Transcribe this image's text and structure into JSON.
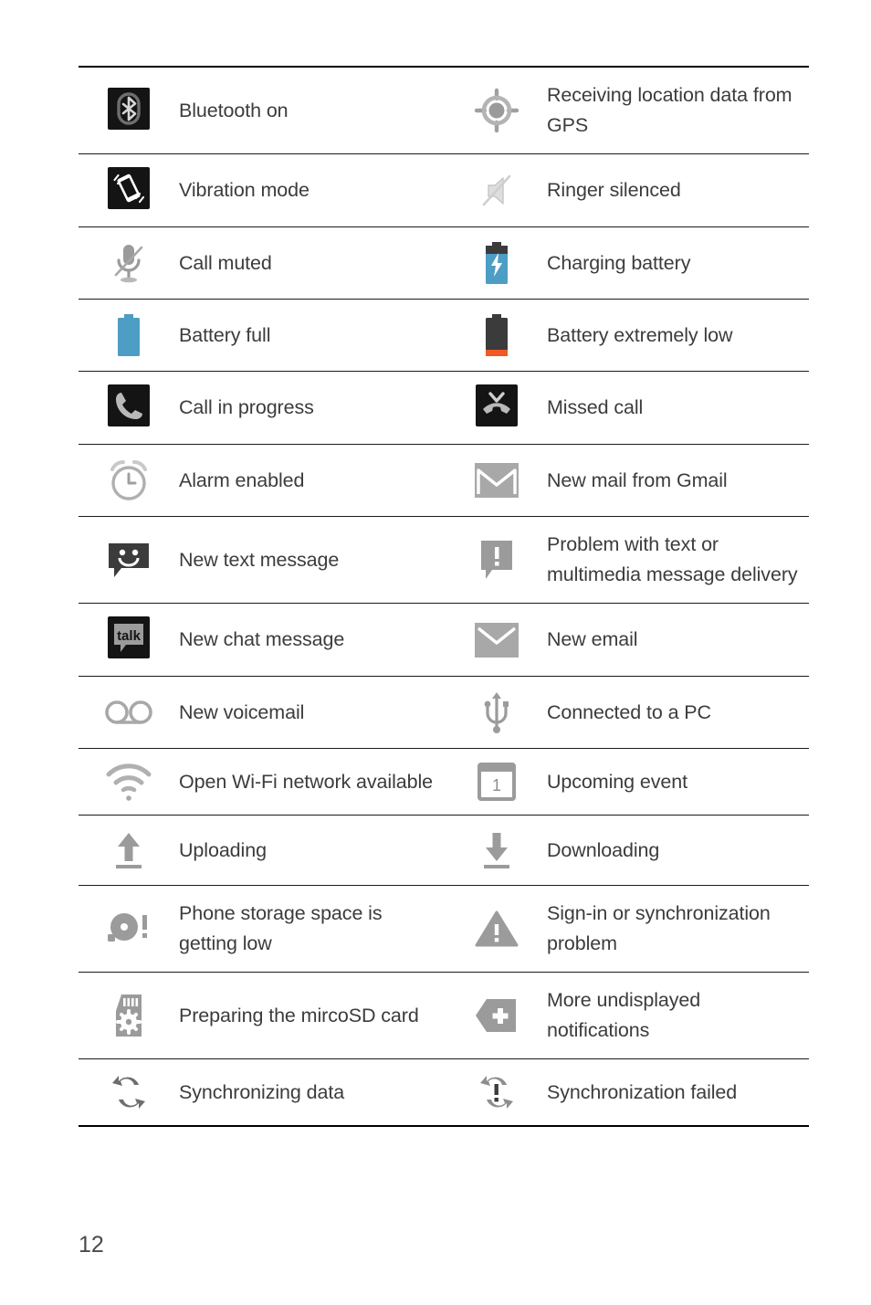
{
  "document": {
    "page_number": "12"
  },
  "table": {
    "rows": [
      {
        "left": {
          "icon": "bluetooth-on-icon",
          "label": "Bluetooth on"
        },
        "right": {
          "icon": "gps-location-icon",
          "label": "Receiving location data from GPS"
        }
      },
      {
        "left": {
          "icon": "vibration-mode-icon",
          "label": "Vibration mode"
        },
        "right": {
          "icon": "ringer-silenced-icon",
          "label": "Ringer silenced"
        }
      },
      {
        "left": {
          "icon": "call-muted-icon",
          "label": "Call muted"
        },
        "right": {
          "icon": "charging-battery-icon",
          "label": "Charging battery"
        }
      },
      {
        "left": {
          "icon": "battery-full-icon",
          "label": "Battery full"
        },
        "right": {
          "icon": "battery-extremely-low-icon",
          "label": "Battery extremely low"
        }
      },
      {
        "left": {
          "icon": "call-in-progress-icon",
          "label": "Call in progress"
        },
        "right": {
          "icon": "missed-call-icon",
          "label": "Missed call"
        }
      },
      {
        "left": {
          "icon": "alarm-enabled-icon",
          "label": "Alarm enabled"
        },
        "right": {
          "icon": "gmail-icon",
          "label": "New mail from Gmail"
        }
      },
      {
        "left": {
          "icon": "new-text-message-icon",
          "label": "New text message"
        },
        "right": {
          "icon": "message-delivery-problem-icon",
          "label": "Problem with text or multimedia message delivery"
        }
      },
      {
        "left": {
          "icon": "new-chat-message-icon",
          "label": "New chat message"
        },
        "right": {
          "icon": "new-email-icon",
          "label": "New email"
        }
      },
      {
        "left": {
          "icon": "new-voicemail-icon",
          "label": "New voicemail"
        },
        "right": {
          "icon": "usb-connected-icon",
          "label": "Connected to a PC"
        }
      },
      {
        "left": {
          "icon": "open-wifi-network-icon",
          "label": "Open Wi-Fi network available"
        },
        "right": {
          "icon": "upcoming-event-icon",
          "label": "Upcoming event"
        }
      },
      {
        "left": {
          "icon": "uploading-icon",
          "label": "Uploading"
        },
        "right": {
          "icon": "downloading-icon",
          "label": "Downloading"
        }
      },
      {
        "left": {
          "icon": "storage-low-icon",
          "label": "Phone storage space is getting low"
        },
        "right": {
          "icon": "sync-problem-warning-icon",
          "label": "Sign-in or synchronization problem"
        }
      },
      {
        "left": {
          "icon": "preparing-microsd-icon",
          "label": "Preparing the mircoSD card"
        },
        "right": {
          "icon": "more-notifications-icon",
          "label": "More undisplayed notifications"
        }
      },
      {
        "left": {
          "icon": "synchronizing-data-icon",
          "label": "Synchronizing data"
        },
        "right": {
          "icon": "synchronization-failed-icon",
          "label": "Synchronization failed"
        }
      }
    ]
  },
  "icon_glyph_text": {
    "talk": "talk",
    "calendar_day": "1"
  },
  "colors": {
    "text": "#3c3c3c",
    "rule": "#1a1a1a",
    "icon_dark": "#141414",
    "icon_gray": "#9a9a9a",
    "battery_blue": "#4d9dc4",
    "battery_low_orange": "#f05a22",
    "battery_dark": "#3b3b3b"
  }
}
